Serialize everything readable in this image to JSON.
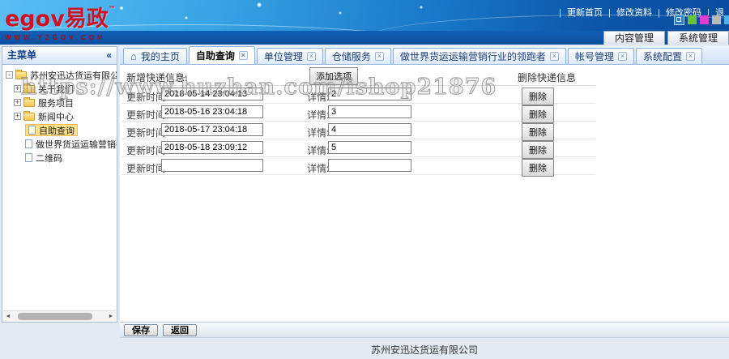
{
  "brand": {
    "logo_text": "egov易政",
    "tm": "™",
    "url_text": "WWW.YZGOV.COM"
  },
  "header": {
    "link_separator": "|",
    "links": [
      "更新首页",
      "修改资料",
      "修改密码",
      "退"
    ],
    "nav_buttons": [
      "内容管理",
      "系统管理"
    ],
    "palette_colors": [
      "#67c43a",
      "#dd3fd6",
      "#b9b9b9",
      "#4fb0ee"
    ]
  },
  "icons": {
    "home": "⌂",
    "close": "×",
    "collapse": "«",
    "scroll_left": "◄",
    "scroll_right": "►",
    "expand_minus": "-",
    "expand_plus": "+"
  },
  "sidebar": {
    "title": "主菜单",
    "root": "苏州安迅达货运有限公司",
    "folders": [
      "关于我们",
      "服务项目",
      "新闻中心"
    ],
    "leaves": [
      "自助查询",
      "做世界货运运输营销行业的",
      "二维码"
    ],
    "selected": "自助查询"
  },
  "tabs": [
    {
      "label": "我的主页"
    },
    {
      "label": "自助查询"
    },
    {
      "label": "单位管理"
    },
    {
      "label": "仓储服务"
    },
    {
      "label": "做世界货运运输营销行业的领跑者"
    },
    {
      "label": "帐号管理"
    },
    {
      "label": "系统配置"
    }
  ],
  "content": {
    "add_label": "新增快递信息:",
    "add_button": "添加选项",
    "delete_header": "删除快递信息",
    "time_label": "更新时间:",
    "detail_label": "详情:",
    "delete_button": "删除",
    "rows": [
      {
        "time": "2018-05-14 23:04:13",
        "detail": "2"
      },
      {
        "time": "2018-05-16 23:04:18",
        "detail": "3"
      },
      {
        "time": "2018-05-17 23:04:18",
        "detail": "4"
      },
      {
        "time": "2018-05-18 23:09:12",
        "detail": "5"
      },
      {
        "time": "",
        "detail": ""
      }
    ]
  },
  "toolbar": {
    "save": "保存",
    "back": "返回"
  },
  "footer": {
    "company": "苏州安迅达货运有限公司"
  },
  "watermark": "https://www.huzhan.com/ishop21876"
}
